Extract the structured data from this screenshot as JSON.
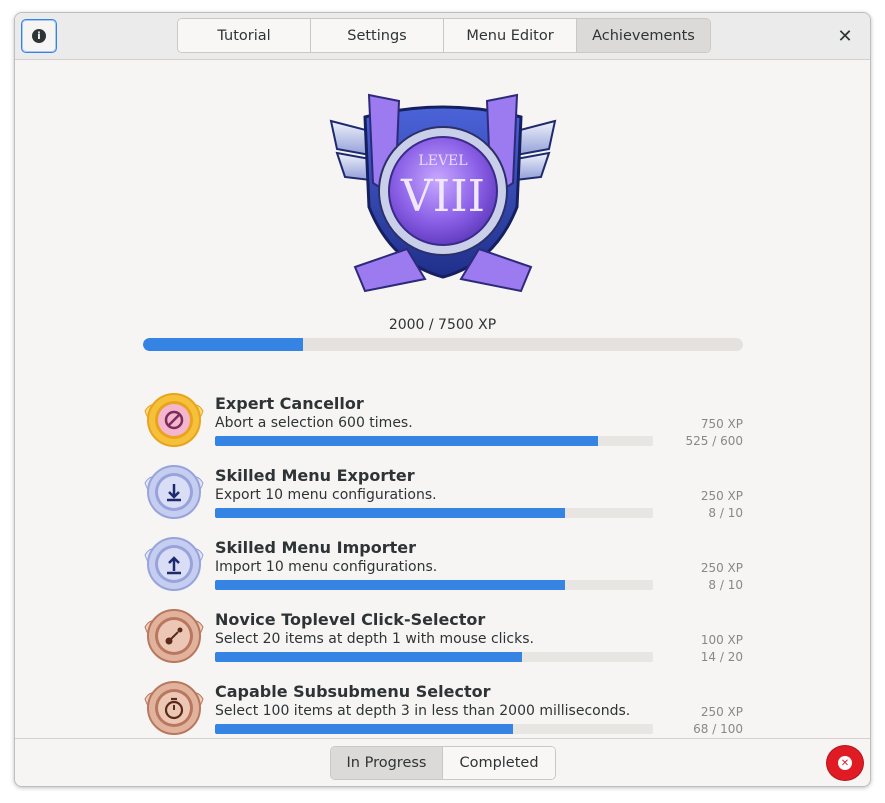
{
  "header": {
    "info_icon": "info-icon",
    "tabs": [
      {
        "label": "Tutorial",
        "active": false
      },
      {
        "label": "Settings",
        "active": false
      },
      {
        "label": "Menu Editor",
        "active": false
      },
      {
        "label": "Achievements",
        "active": true
      }
    ],
    "close_icon": "close-icon"
  },
  "level": {
    "emblem_text_small": "LEVEL",
    "emblem_text_large": "VIII",
    "xp_label": "2000 / 7500 XP",
    "progress_fraction": 0.2667
  },
  "achievements": [
    {
      "name": "Expert Cancellor",
      "description": "Abort a selection 600 times.",
      "xp": "750 XP",
      "count": "525 / 600",
      "progress_fraction": 0.875,
      "tier": "gold",
      "icon": "cancel-icon"
    },
    {
      "name": "Skilled Menu Exporter",
      "description": "Export 10 menu configurations.",
      "xp": "250 XP",
      "count": "8 / 10",
      "progress_fraction": 0.8,
      "tier": "silver",
      "icon": "download-icon"
    },
    {
      "name": "Skilled Menu Importer",
      "description": "Import 10 menu configurations.",
      "xp": "250 XP",
      "count": "8 / 10",
      "progress_fraction": 0.8,
      "tier": "silver",
      "icon": "upload-icon"
    },
    {
      "name": "Novice Toplevel Click-Selector",
      "description": "Select 20 items at depth 1 with mouse clicks.",
      "xp": "100 XP",
      "count": "14 / 20",
      "progress_fraction": 0.7,
      "tier": "bronze",
      "icon": "click-path-icon"
    },
    {
      "name": "Capable Subsubmenu Selector",
      "description": "Select 100 items at depth 3 in less than 2000 milliseconds.",
      "xp": "250 XP",
      "count": "68 / 100",
      "progress_fraction": 0.68,
      "tier": "bronze",
      "icon": "stopwatch-icon"
    }
  ],
  "footer": {
    "switcher": [
      {
        "label": "In Progress",
        "active": true
      },
      {
        "label": "Completed",
        "active": false
      }
    ],
    "stop_icon": "stop-icon"
  },
  "colors": {
    "accent": "#3584e4",
    "danger": "#e01b24",
    "gold": "#f3c43b",
    "silver": "#b9c3e8",
    "bronze": "#d9a48a",
    "emblem_purple": "#7b5ce0"
  }
}
